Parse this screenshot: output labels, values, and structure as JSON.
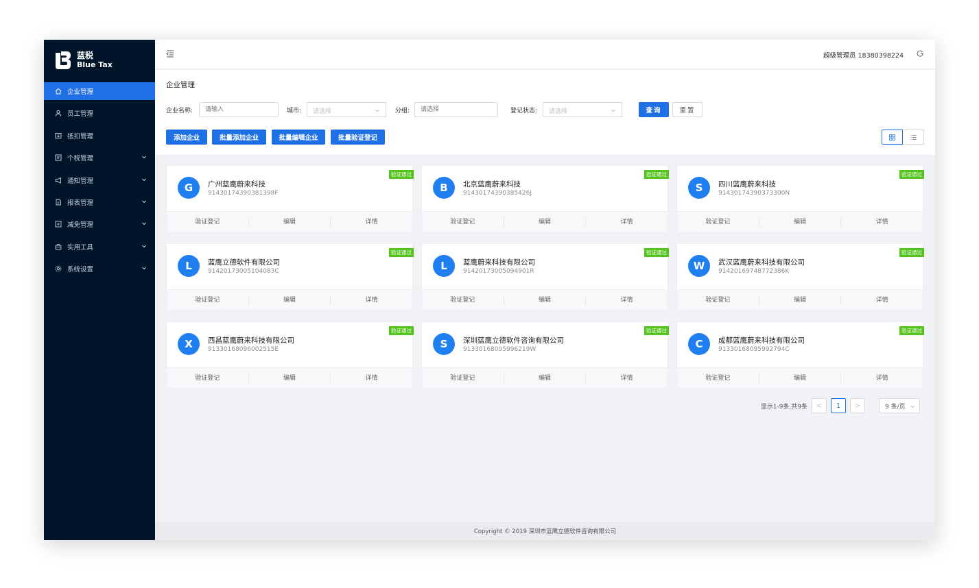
{
  "brand": {
    "cn": "蓝税",
    "en": "Blue Tax"
  },
  "sidebar": {
    "items": [
      {
        "label": "企业管理",
        "icon": "home-icon",
        "active": true,
        "expandable": false
      },
      {
        "label": "员工管理",
        "icon": "user-icon",
        "active": false,
        "expandable": false
      },
      {
        "label": "抵扣管理",
        "icon": "deduct-icon",
        "active": false,
        "expandable": false
      },
      {
        "label": "个税管理",
        "icon": "tax-icon",
        "active": false,
        "expandable": true
      },
      {
        "label": "通知管理",
        "icon": "notify-icon",
        "active": false,
        "expandable": true
      },
      {
        "label": "报表管理",
        "icon": "report-icon",
        "active": false,
        "expandable": true
      },
      {
        "label": "减免管理",
        "icon": "relief-icon",
        "active": false,
        "expandable": true
      },
      {
        "label": "实用工具",
        "icon": "tool-icon",
        "active": false,
        "expandable": true
      },
      {
        "label": "系统设置",
        "icon": "gear-icon",
        "active": false,
        "expandable": true
      }
    ]
  },
  "header": {
    "user": "超级管理员 18380398224"
  },
  "page": {
    "title": "企业管理"
  },
  "filters": {
    "name_label": "企业名称:",
    "name_placeholder": "请输入",
    "city_label": "城市:",
    "city_placeholder": "请选择",
    "group_label": "分组:",
    "group_placeholder": "请选择",
    "status_label": "登记状态:",
    "status_placeholder": "请选择",
    "query_label": "查询",
    "reset_label": "重置"
  },
  "actions": {
    "add": "添加企业",
    "batch_add": "批量添加企业",
    "batch_edit": "批量编辑企业",
    "batch_verify": "批量验证登记"
  },
  "card_actions": {
    "verify": "验证登记",
    "edit": "编辑",
    "detail": "详情"
  },
  "companies": [
    {
      "initial": "G",
      "name": "广州蓝鹰蔚来科技",
      "code": "91430174390381398F",
      "badge": "验证通过"
    },
    {
      "initial": "B",
      "name": "北京蓝鹰蔚来科技",
      "code": "91430174390385426J",
      "badge": "验证通过"
    },
    {
      "initial": "S",
      "name": "四川蓝鹰蔚来科技",
      "code": "91430174390373300N",
      "badge": "验证通过"
    },
    {
      "initial": "L",
      "name": "蓝鹰立德软件有限公司",
      "code": "91420173005104083C",
      "badge": "验证通过"
    },
    {
      "initial": "L",
      "name": "蓝鹰蔚来科技有限公司",
      "code": "91420173005094901R",
      "badge": "验证通过"
    },
    {
      "initial": "W",
      "name": "武汉蓝鹰蔚来科技有限公司",
      "code": "91420169748772386K",
      "badge": "验证通过"
    },
    {
      "initial": "X",
      "name": "西昌蓝鹰蔚来科技有限公司",
      "code": "91330168096002515E",
      "badge": "验证通过"
    },
    {
      "initial": "S",
      "name": "深圳蓝鹰立德软件咨询有限公司",
      "code": "91330168095996219W",
      "badge": "验证通过"
    },
    {
      "initial": "C",
      "name": "成都蓝鹰蔚来科技有限公司",
      "code": "91330168095992794C",
      "badge": "验证通过"
    }
  ],
  "pagination": {
    "total_text": "显示1-9条,共9条",
    "current": "1",
    "prev": "<",
    "next": ">",
    "page_size": "9 条/页"
  },
  "footer": {
    "copyright": "Copyright © 2019 深圳市蓝鹰立德软件咨询有限公司"
  },
  "colors": {
    "sidebar_bg": "#001529",
    "primary": "#1f6fe5",
    "badge": "#52c41a",
    "avatar": "#1f7ff0"
  }
}
